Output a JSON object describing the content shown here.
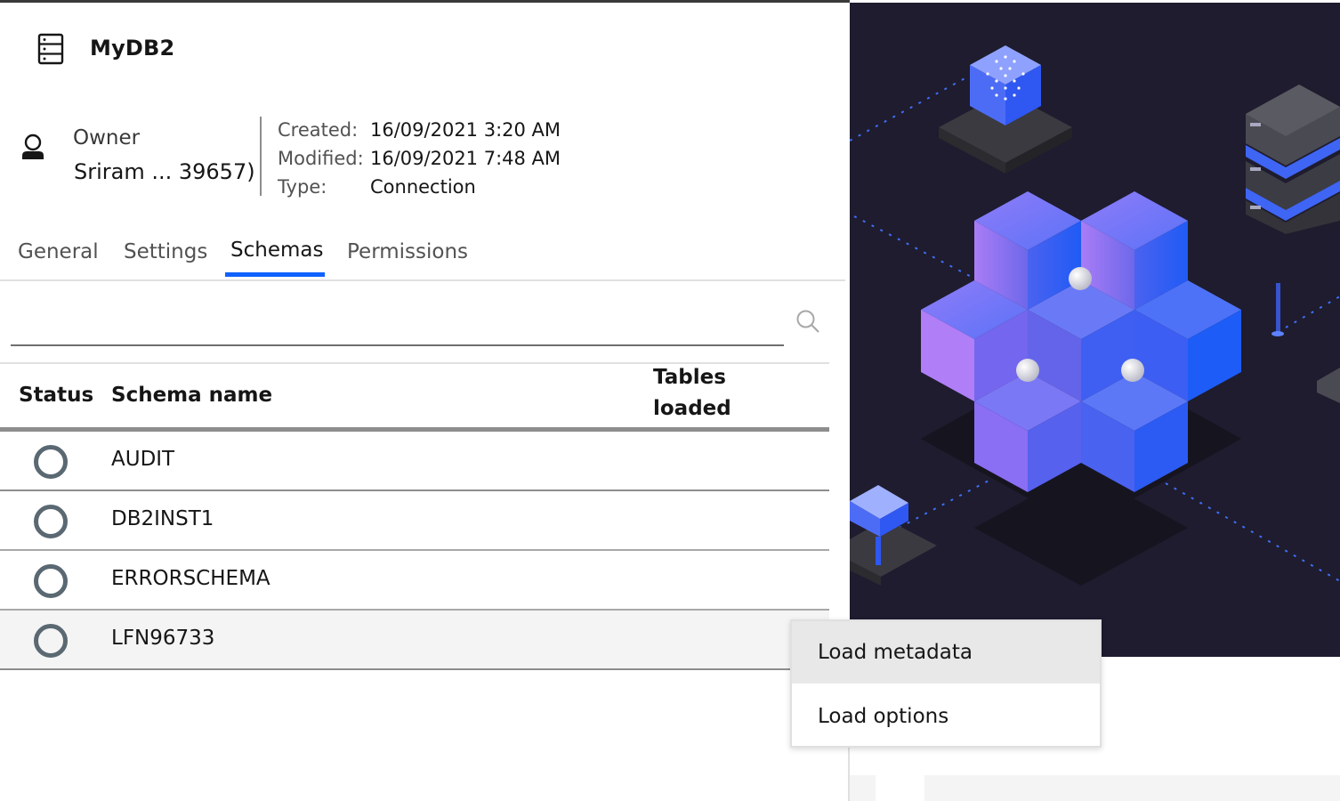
{
  "header": {
    "title": "MyDB2",
    "owner_label": "Owner",
    "owner_name": "Sriram ... 39657)"
  },
  "meta": [
    {
      "key": "Created:",
      "value": "16/09/2021 3:20 AM"
    },
    {
      "key": "Modified:",
      "value": "16/09/2021 7:48 AM"
    },
    {
      "key": "Type:",
      "value": "Connection"
    }
  ],
  "tabs": [
    {
      "label": "General"
    },
    {
      "label": "Settings"
    },
    {
      "label": "Schemas",
      "active": true
    },
    {
      "label": "Permissions"
    }
  ],
  "search": {
    "placeholder": ""
  },
  "table": {
    "columns": [
      "Status",
      "Schema name",
      "Tables loaded"
    ],
    "column_tables_line1": "Tables",
    "column_tables_line2": "loaded",
    "rows": [
      {
        "name": "AUDIT"
      },
      {
        "name": "DB2INST1"
      },
      {
        "name": "ERRORSCHEMA"
      },
      {
        "name": "LFN96733"
      }
    ]
  },
  "context_menu": {
    "items": [
      "Load metadata",
      "Load options"
    ]
  },
  "colors": {
    "accent": "#0f62fe",
    "illustration_bg": "#1e1c2e",
    "cube_blue": "#3d6bf7",
    "cube_purple": "#8f6cf5"
  }
}
